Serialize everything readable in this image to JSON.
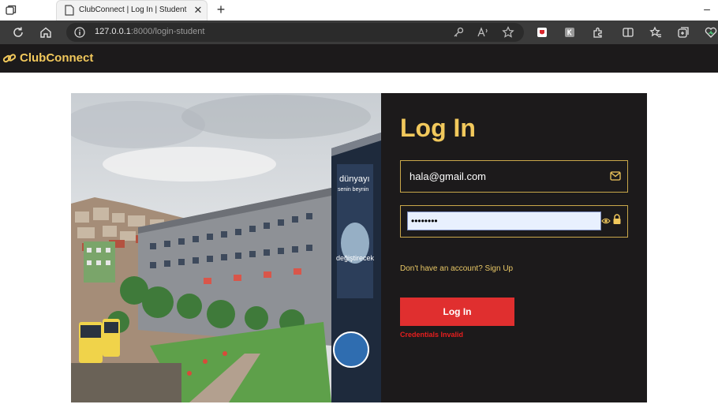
{
  "browser": {
    "tab_title": "ClubConnect | Log In | Student",
    "url_host": "127.0.0.1",
    "url_rest": ":8000/login-student"
  },
  "app": {
    "brand": "ClubConnect",
    "accent_color": "#f1c85c"
  },
  "login": {
    "title": "Log In",
    "email_value": "hala@gmail.com",
    "password_mask": "••••••••",
    "signup_text": "Don't have an account? Sign Up",
    "button_label": "Log In",
    "error_text": "Credentials Invalid",
    "error_color": "#e81e1e"
  },
  "photo_signage": [
    "dünyayı",
    "senin beynin",
    "değiştirecek"
  ]
}
